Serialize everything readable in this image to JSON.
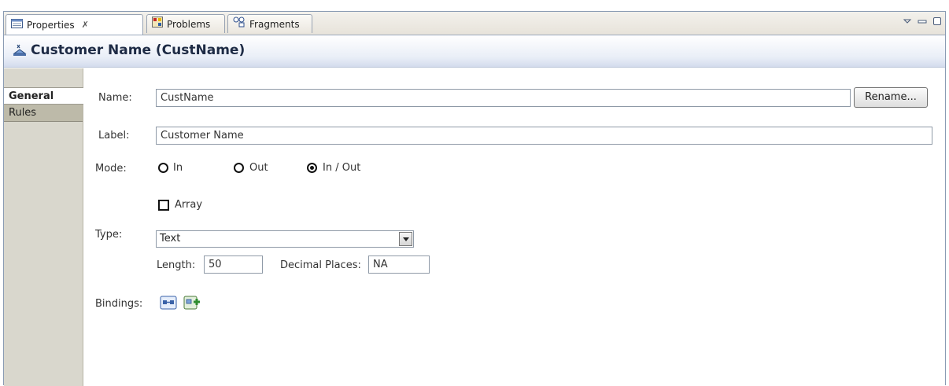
{
  "tabs": {
    "properties": "Properties",
    "close_glyph": "✗",
    "problems": "Problems",
    "fragments": "Fragments"
  },
  "header": {
    "title": "Customer Name (CustName)"
  },
  "side_tabs": {
    "general": "General",
    "rules": "Rules"
  },
  "form": {
    "name_label": "Name:",
    "name_value": "CustName",
    "rename_label": "Rename...",
    "label_label": "Label:",
    "label_value": "Customer Name",
    "mode_label": "Mode:",
    "mode_options": [
      "In",
      "Out",
      "In / Out"
    ],
    "mode_selected": "In / Out",
    "array_label": "Array",
    "array_checked": false,
    "type_label": "Type:",
    "type_value": "Text",
    "length_label": "Length:",
    "length_value": "50",
    "decimal_label": "Decimal Places:",
    "decimal_value": "NA",
    "bindings_label": "Bindings:"
  },
  "icons": {
    "title": "data-field-icon",
    "binding_1": "binding-connect-icon",
    "binding_2": "binding-add-icon"
  },
  "colors": {
    "title_text": "#1e2b45",
    "side_bg": "#d9d7cd",
    "frame_border": "#8a9bb3"
  }
}
